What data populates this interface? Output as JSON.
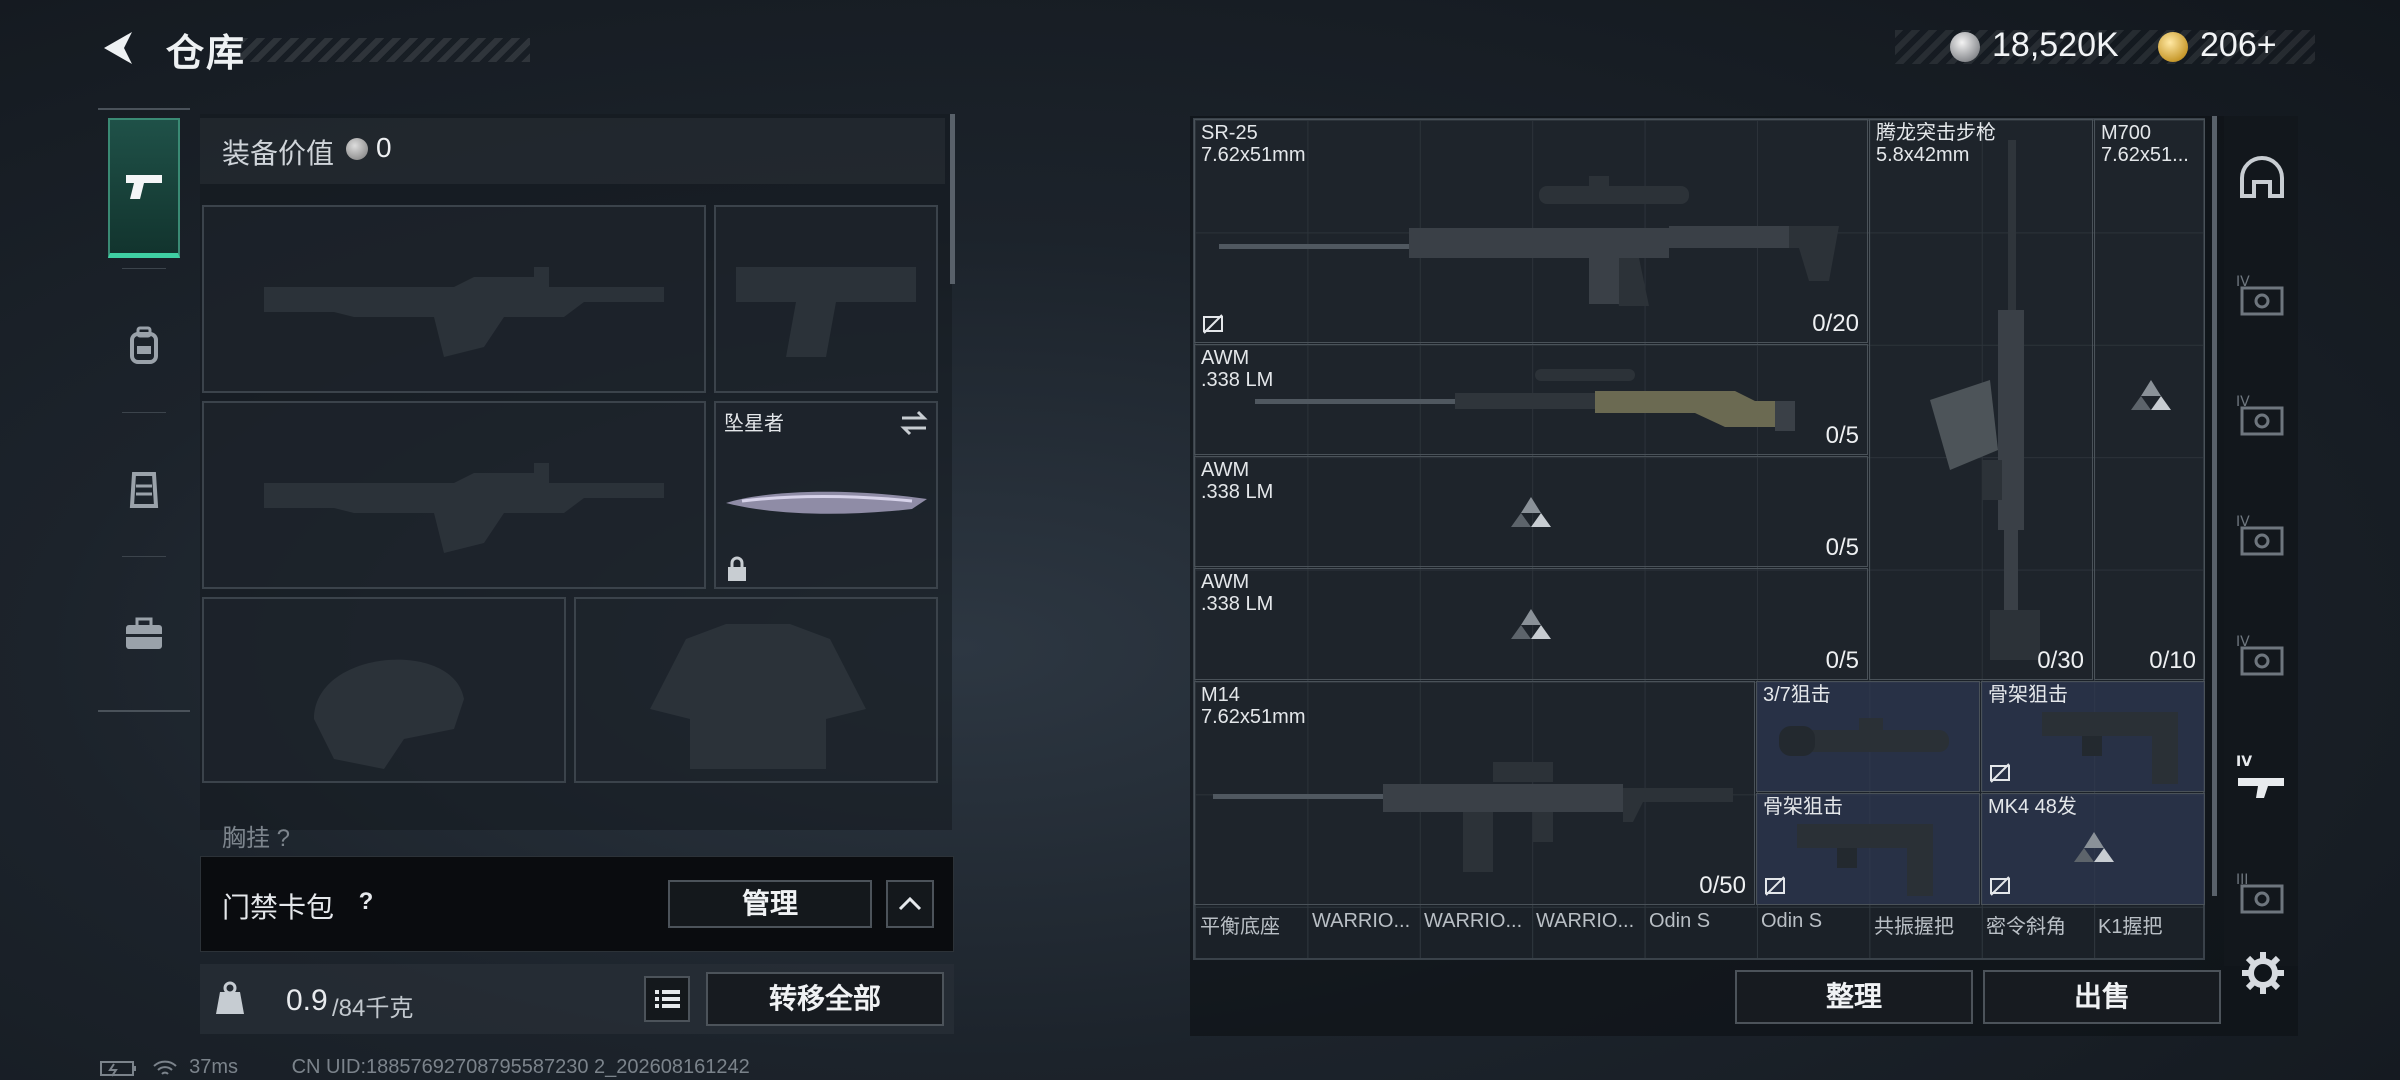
{
  "header": {
    "title": "仓库",
    "silver_amount": "18,520K",
    "gold_amount": "206+"
  },
  "left_rail": {
    "tabs": [
      "firearms-icon",
      "backpack-icon",
      "vest-icon",
      "case-icon"
    ],
    "active": 0
  },
  "equipment": {
    "value_label": "装备价值",
    "value": "0",
    "melee_name": "坠星者",
    "chest_label": "胸挂 ?",
    "keycard_label": "门禁卡包",
    "keycard_help": "?",
    "manage_label": "管理",
    "weight_current": "0.9",
    "weight_max": "/84千克",
    "transfer_label": "转移全部"
  },
  "status": {
    "ping": "37ms",
    "uid": "CN UID:18857692708795587230 2_202608161242"
  },
  "warehouse": {
    "items": [
      {
        "name": "SR-25",
        "caliber": "7.62x51mm",
        "ammo": "0/20"
      },
      {
        "name": "AWM",
        "caliber": ".338 LM",
        "ammo": "0/5"
      },
      {
        "name": "AWM",
        "caliber": ".338 LM",
        "ammo": "0/5"
      },
      {
        "name": "AWM",
        "caliber": ".338 LM",
        "ammo": "0/5"
      },
      {
        "name": "腾龙突击步枪",
        "caliber": "5.8x42mm",
        "ammo": "0/30"
      },
      {
        "name": "M700",
        "caliber": "7.62x51...",
        "ammo": "0/10"
      },
      {
        "name": "M14",
        "caliber": "7.62x51mm",
        "ammo": "0/50"
      },
      {
        "name": "3/7狙击",
        "caliber": "",
        "ammo": ""
      },
      {
        "name": "骨架狙击",
        "caliber": "",
        "ammo": ""
      },
      {
        "name": "骨架狙击",
        "caliber": "",
        "ammo": ""
      },
      {
        "name": "MK4 48发",
        "caliber": "",
        "ammo": ""
      }
    ],
    "attachments": [
      "平衡底座",
      "WARRIO...",
      "WARRIO...",
      "WARRIO...",
      "Odin S",
      "Odin S",
      "共振握把",
      "密令斜角",
      "K1握把"
    ],
    "sort_label": "整理",
    "sell_label": "出售"
  },
  "right_rail": {
    "icons": [
      "helmet-icon",
      "tier-iv-case-icon",
      "tier-iv-case-icon",
      "tier-iv-case-icon",
      "tier-iv-case-icon",
      "tier-iv-rifle-icon",
      "tier-iii-case-icon",
      "gear-icon"
    ]
  },
  "colors": {
    "accent": "#3fd0a3",
    "button_border": "#4c535a",
    "blue_slot": "#2d3750"
  }
}
